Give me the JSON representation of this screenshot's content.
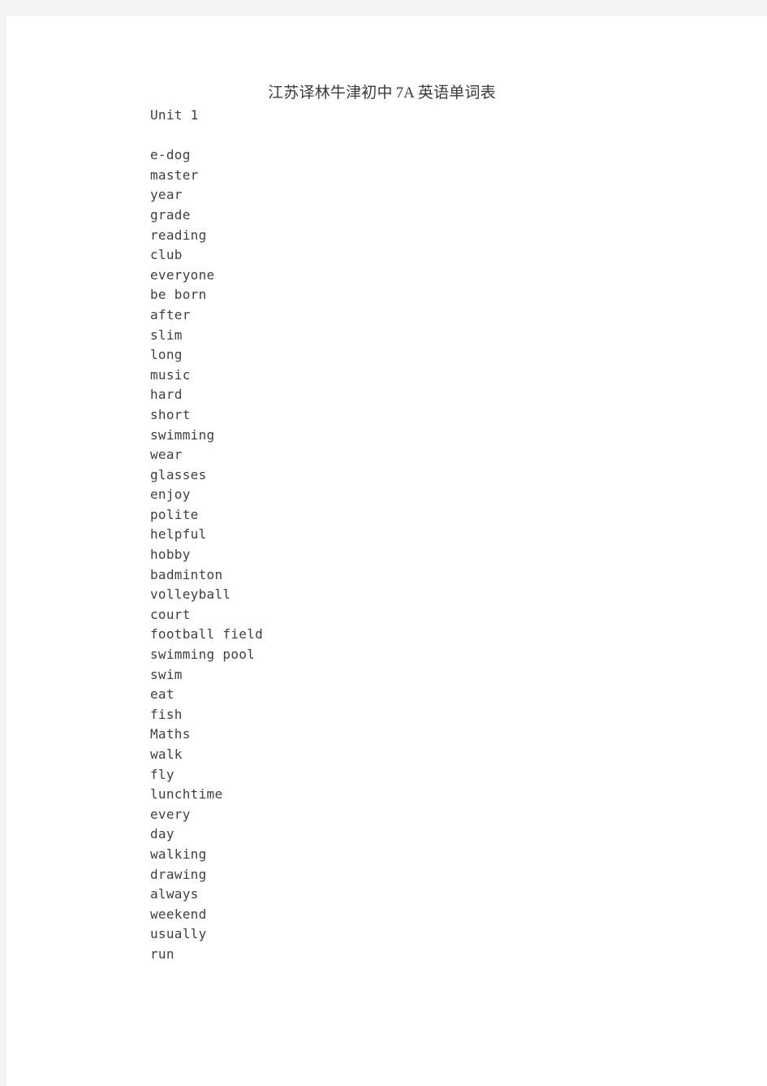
{
  "document": {
    "title": "江苏译林牛津初中 7A 英语单词表",
    "title_parts": {
      "cjk_leading": "江苏译林牛津初中",
      "latin": "7A",
      "cjk_trailing": "英语单词表"
    },
    "unit_heading": "Unit 1",
    "colors": {
      "page_background": "#ffffff",
      "canvas_background": "#f4f4f4",
      "title_text": "#3a3a3a",
      "body_text": "#3f3f3f"
    },
    "words": [
      "e-dog",
      "master",
      "year",
      "grade",
      "reading",
      "club",
      "everyone",
      "be born",
      "after",
      "slim",
      "long",
      "music",
      "hard",
      "short",
      "swimming",
      "wear",
      "glasses",
      "enjoy",
      "polite",
      "helpful",
      "hobby",
      "badminton",
      "volleyball",
      "court",
      "football field",
      "swimming pool",
      "swim",
      "eat",
      "fish",
      "Maths",
      "walk",
      "fly",
      "lunchtime",
      "every",
      "day",
      "walking",
      "drawing",
      "always",
      "weekend",
      "usually",
      "run"
    ]
  }
}
